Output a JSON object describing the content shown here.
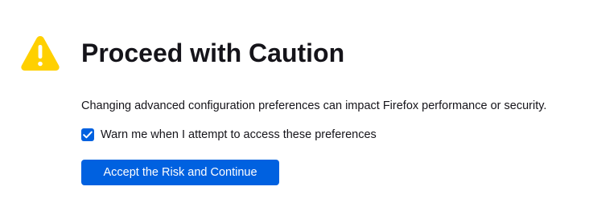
{
  "warning_icon": {
    "name": "warning-triangle-icon",
    "color": "#ffd000"
  },
  "title": "Proceed with Caution",
  "description": "Changing advanced configuration preferences can impact Firefox performance or security.",
  "warn_checkbox": {
    "label": "Warn me when I attempt to access these preferences",
    "checked": true,
    "color": "#0061e0"
  },
  "accept_button": {
    "label": "Accept the Risk and Continue",
    "color": "#0061e0"
  }
}
